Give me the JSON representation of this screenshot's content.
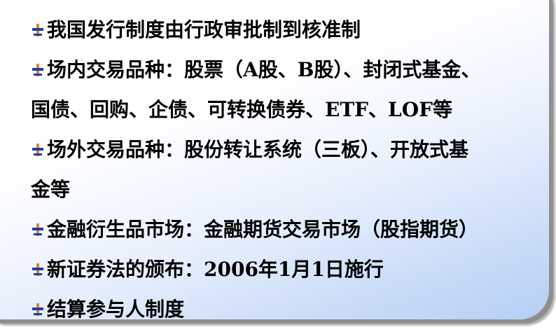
{
  "colors": {
    "bullet_stem": "#d98a14",
    "bullet_bar": "#1e3fa8",
    "text": "#000000",
    "gradient_end": "#b6cff4"
  },
  "bullet_icon": "plus-cross-icon",
  "lines": [
    {
      "text": "我国发行制度由行政审批制到核准制",
      "bullet": true
    },
    {
      "text": "场内交易品种：股票（A股、B股）、封闭式基金、",
      "bullet": true
    },
    {
      "text": "国债、回购、企债、可转换债券、ETF、LOF等",
      "bullet": false
    },
    {
      "text": "场外交易品种：股份转让系统（三板）、开放式基",
      "bullet": true
    },
    {
      "text": "金等",
      "bullet": false
    },
    {
      "text": "金融衍生品市场：金融期货交易市场（股指期货）",
      "bullet": true
    },
    {
      "text": "新证券法的颁布：2006年1月1日施行",
      "bullet": true
    },
    {
      "text": "结算参与人制度",
      "bullet": true
    }
  ]
}
